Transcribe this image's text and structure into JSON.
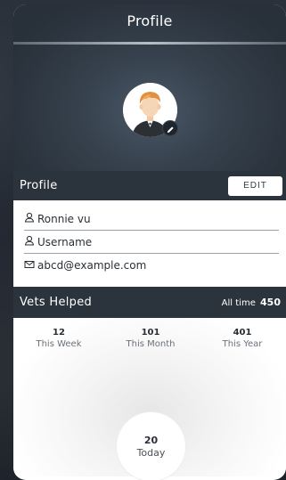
{
  "header": {
    "title": "Profile",
    "edit_icon": "pencil-icon"
  },
  "profile": {
    "section_label": "Profile",
    "edit_button": "EDIT",
    "fields": [
      {
        "icon": "user-icon",
        "value": "Ronnie vu"
      },
      {
        "icon": "user-icon",
        "value": "Username"
      },
      {
        "icon": "mail-icon",
        "value": "abcd@example.com"
      }
    ]
  },
  "vets": {
    "section_label": "Vets Helped",
    "all_time_label": "All time",
    "all_time_value": "450",
    "stats": [
      {
        "value": "12",
        "label": "This Week"
      },
      {
        "value": "101",
        "label": "This Month"
      },
      {
        "value": "401",
        "label": "This Year"
      }
    ],
    "today": {
      "value": "20",
      "label": "Today"
    }
  }
}
